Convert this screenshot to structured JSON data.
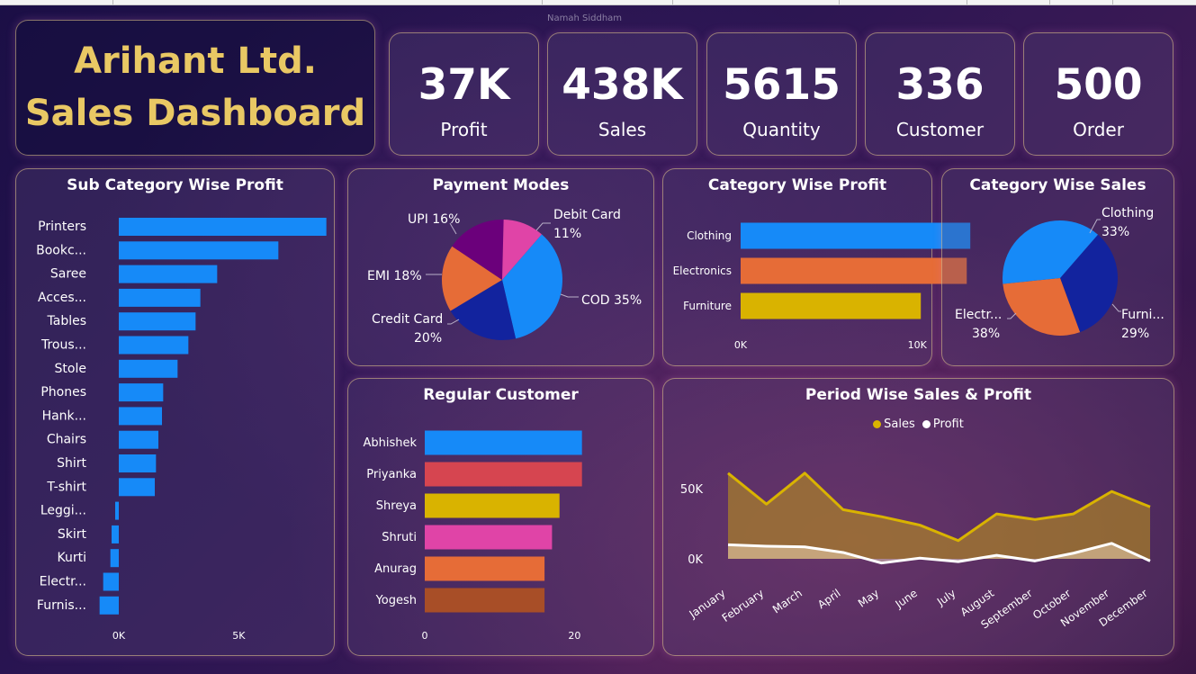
{
  "header": {
    "author": "Namah Siddham",
    "title_line1": "Arihant Ltd.",
    "title_line2": "Sales Dashboard",
    "title_color": "#e9c864"
  },
  "kpis": [
    {
      "value": "37K",
      "label": "Profit"
    },
    {
      "value": "438K",
      "label": "Sales"
    },
    {
      "value": "5615",
      "label": "Quantity"
    },
    {
      "value": "336",
      "label": "Customer"
    },
    {
      "value": "500",
      "label": "Order"
    }
  ],
  "colors": {
    "blue": "#168af8",
    "orange": "#e66c37",
    "gold": "#d9b300",
    "navy": "#12239e",
    "purple": "#6b007b",
    "pink": "#e044a7",
    "red": "#d64550",
    "brown": "#a84e27"
  },
  "chart_data": [
    {
      "id": "subcat",
      "type": "bar",
      "orientation": "horizontal",
      "title": "Sub Category Wise Profit",
      "categories": [
        "Printers",
        "Bookc...",
        "Saree",
        "Acces...",
        "Tables",
        "Trous...",
        "Stole",
        "Phones",
        "Hank...",
        "Chairs",
        "Shirt",
        "T-shirt",
        "Leggi...",
        "Skirt",
        "Kurti",
        "Electr...",
        "Furnis..."
      ],
      "values": [
        8650,
        6650,
        4100,
        3400,
        3200,
        2900,
        2450,
        1850,
        1800,
        1650,
        1550,
        1500,
        -150,
        -300,
        -350,
        -650,
        -800
      ],
      "xticks": [
        "0K",
        "5K"
      ],
      "xlim": [
        -900,
        9000
      ],
      "color": "#168af8"
    },
    {
      "id": "payment",
      "type": "pie",
      "title": "Payment Modes",
      "labels": [
        "COD",
        "Credit Card",
        "EMI",
        "UPI",
        "Debit Card"
      ],
      "values": [
        35,
        20,
        18,
        16,
        11
      ],
      "colors": [
        "#168af8",
        "#12239e",
        "#e66c37",
        "#6b007b",
        "#e044a7"
      ],
      "label_texts": [
        "COD 35%",
        "Credit Card",
        "20%",
        "EMI 18%",
        "UPI 16%",
        "Debit Card",
        "11%"
      ]
    },
    {
      "id": "catprofit",
      "type": "bar",
      "orientation": "horizontal",
      "title": "Category Wise Profit",
      "categories": [
        "Clothing",
        "Electronics",
        "Furniture"
      ],
      "values": [
        13000,
        12800,
        10200
      ],
      "colors": [
        "#168af8",
        "#e66c37",
        "#d9b300"
      ],
      "xticks": [
        "0K",
        "10K"
      ],
      "xlim": [
        0,
        13500
      ]
    },
    {
      "id": "catsales",
      "type": "pie",
      "title": "Category Wise Sales",
      "labels": [
        "Clothing",
        "Furniture",
        "Electronics"
      ],
      "values": [
        33,
        29,
        38
      ],
      "colors": [
        "#12239e",
        "#e66c37",
        "#168af8"
      ],
      "label_texts": [
        "Clothing",
        "33%",
        "Furni...",
        "29%",
        "Electr...",
        "38%"
      ]
    },
    {
      "id": "regular",
      "type": "bar",
      "orientation": "horizontal",
      "title": "Regular Customer",
      "categories": [
        "Abhishek",
        "Priyanka",
        "Shreya",
        "Shruti",
        "Anurag",
        "Yogesh"
      ],
      "values": [
        21,
        21,
        18,
        17,
        16,
        16
      ],
      "colors": [
        "#168af8",
        "#d64550",
        "#d9b300",
        "#e044a7",
        "#e66c37",
        "#a84e27"
      ],
      "xticks": [
        "0",
        "20"
      ],
      "xlim": [
        0,
        22
      ]
    },
    {
      "id": "period",
      "type": "area",
      "title": "Period Wise Sales & Profit",
      "categories": [
        "January",
        "February",
        "March",
        "April",
        "May",
        "June",
        "July",
        "August",
        "September",
        "October",
        "November",
        "December"
      ],
      "series": [
        {
          "name": "Sales",
          "values": [
            61000,
            39000,
            61000,
            35000,
            30000,
            24000,
            13000,
            32000,
            28000,
            32000,
            48000,
            37000
          ],
          "color": "#d9b300"
        },
        {
          "name": "Profit",
          "values": [
            10000,
            9000,
            8500,
            4500,
            -3000,
            500,
            -2000,
            2500,
            -1500,
            4000,
            11000,
            -1500
          ],
          "color": "#ffffff"
        }
      ],
      "yticks": [
        "0K",
        "50K"
      ],
      "ylim": [
        -4000,
        66000
      ],
      "legend": "top-center"
    }
  ]
}
